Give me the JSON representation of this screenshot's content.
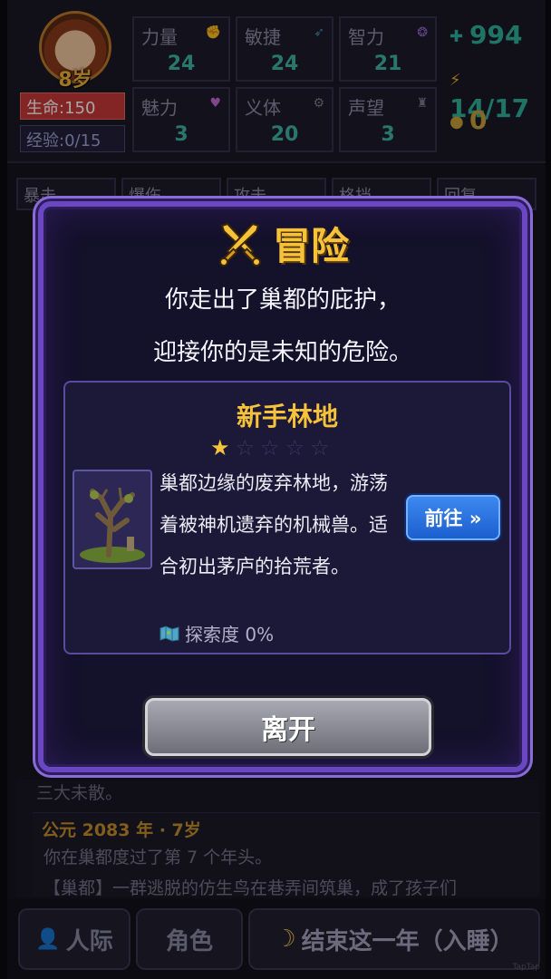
{
  "player": {
    "age": "8岁",
    "hp": "生命:150",
    "xp": "经验:0/15"
  },
  "stats": [
    {
      "name": "力量",
      "value": "24",
      "icon": "fist-icon"
    },
    {
      "name": "敏捷",
      "value": "24",
      "icon": "wing-icon"
    },
    {
      "name": "智力",
      "value": "21",
      "icon": "brain-icon"
    },
    {
      "name": "魅力",
      "value": "3",
      "icon": "heart-icon"
    },
    {
      "name": "义体",
      "value": "20",
      "icon": "arm-icon"
    },
    {
      "name": "声望",
      "value": "3",
      "icon": "tower-icon"
    }
  ],
  "resources": {
    "gems": "994",
    "energy": "14/17",
    "coins": "0",
    "gems_color": "#2fb39c",
    "energy_color": "#2fb39c",
    "coins_color": "#c9a23a"
  },
  "partial_tabs": [
    "暴击",
    "爆伤",
    "攻击",
    "格挡",
    "回复"
  ],
  "log": {
    "prev_line": "三大未散。",
    "year_title": "公元 2083 年 · 7岁",
    "line1": "你在巢都度过了第 7 个年头。",
    "line2": "【巢都】一群逃脱的仿生鸟在巷弄间筑巢，成了孩子们"
  },
  "bottom_bar": {
    "relations": "人际",
    "character": "角色",
    "end_year": "结束这一年（入睡）"
  },
  "watermark": "TapTap",
  "modal": {
    "title": "冒险",
    "intro_line1": "你走出了巢都的庇护，",
    "intro_line2": "迎接你的是未知的危险。",
    "location": {
      "name": "新手林地",
      "stars_filled": 1,
      "stars_total": 5,
      "description": "巢都边缘的废弃林地，游荡着被神机遗弃的机械兽。适合初出茅庐的拾荒者。",
      "exploration": "探索度 0%",
      "go_label": "前往 »"
    },
    "leave_label": "离开",
    "accent_color": "#f5c23a",
    "frame_color": "#6b48c2"
  }
}
